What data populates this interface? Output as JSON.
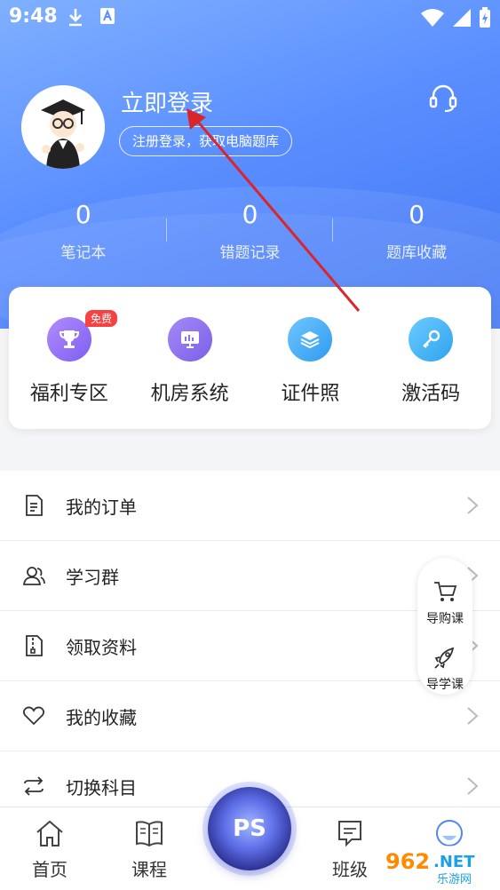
{
  "status_bar": {
    "time": "9:48"
  },
  "profile": {
    "login_title": "立即登录",
    "login_subtitle": "注册登录，获取电脑题库"
  },
  "stats": [
    {
      "value": "0",
      "label": "笔记本"
    },
    {
      "value": "0",
      "label": "错题记录"
    },
    {
      "value": "0",
      "label": "题库收藏"
    }
  ],
  "features": [
    {
      "label": "福利专区",
      "icon": "trophy-icon",
      "badge": "免费",
      "color": "#9b7bf3"
    },
    {
      "label": "机房系统",
      "icon": "monitor-chart-icon",
      "color": "#8b6ff0"
    },
    {
      "label": "证件照",
      "icon": "layers-icon",
      "color": "#3aa8f5"
    },
    {
      "label": "激活码",
      "icon": "key-icon",
      "color": "#36aef2"
    }
  ],
  "menu": [
    {
      "label": "我的订单",
      "icon": "document-icon"
    },
    {
      "label": "学习群",
      "icon": "group-icon"
    },
    {
      "label": "领取资料",
      "icon": "file-zip-icon"
    },
    {
      "label": "我的收藏",
      "icon": "heart-icon"
    },
    {
      "label": "切换科目",
      "icon": "swap-icon"
    }
  ],
  "floating": [
    {
      "label": "导购课",
      "icon": "cart-icon"
    },
    {
      "label": "导学课",
      "icon": "rocket-icon"
    }
  ],
  "bottom_nav": [
    {
      "label": "首页",
      "icon": "home-icon"
    },
    {
      "label": "课程",
      "icon": "book-icon"
    },
    {
      "label": "PS",
      "icon": "ps-logo"
    },
    {
      "label": "班级",
      "icon": "chat-icon"
    },
    {
      "label": "",
      "icon": "profile-icon"
    }
  ],
  "watermark": "962.NET 乐游网",
  "colors": {
    "primary": "#4f86f7",
    "badge": "#f64242",
    "annotation": "#d9262c"
  }
}
